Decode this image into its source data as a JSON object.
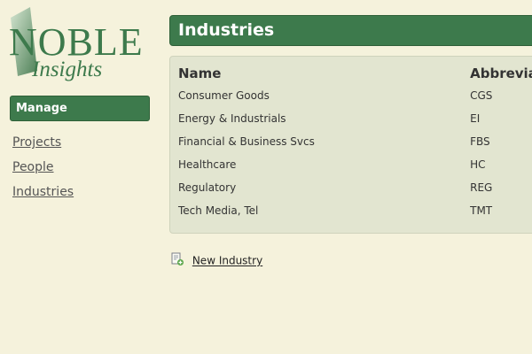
{
  "logo": {
    "brand": "NOBLE",
    "tagline": "Insights"
  },
  "sidebar": {
    "section_title": "Manage",
    "items": [
      {
        "label": "Projects"
      },
      {
        "label": "People"
      },
      {
        "label": "Industries"
      }
    ]
  },
  "main": {
    "title": "Industries",
    "table": {
      "headers": [
        "Name",
        "Abbrevia"
      ],
      "rows": [
        {
          "name": "Consumer Goods",
          "abbr": "CGS"
        },
        {
          "name": "Energy & Industrials",
          "abbr": "EI"
        },
        {
          "name": "Financial & Business Svcs",
          "abbr": "FBS"
        },
        {
          "name": "Healthcare",
          "abbr": "HC"
        },
        {
          "name": "Regulatory",
          "abbr": "REG"
        },
        {
          "name": "Tech Media, Tel",
          "abbr": "TMT"
        }
      ]
    },
    "new_link": {
      "label": "New Industry",
      "icon": "new-document-icon"
    }
  },
  "colors": {
    "brand_green": "#3d7a4c",
    "background": "#f5f2dc",
    "panel": "#e2e5d0"
  }
}
